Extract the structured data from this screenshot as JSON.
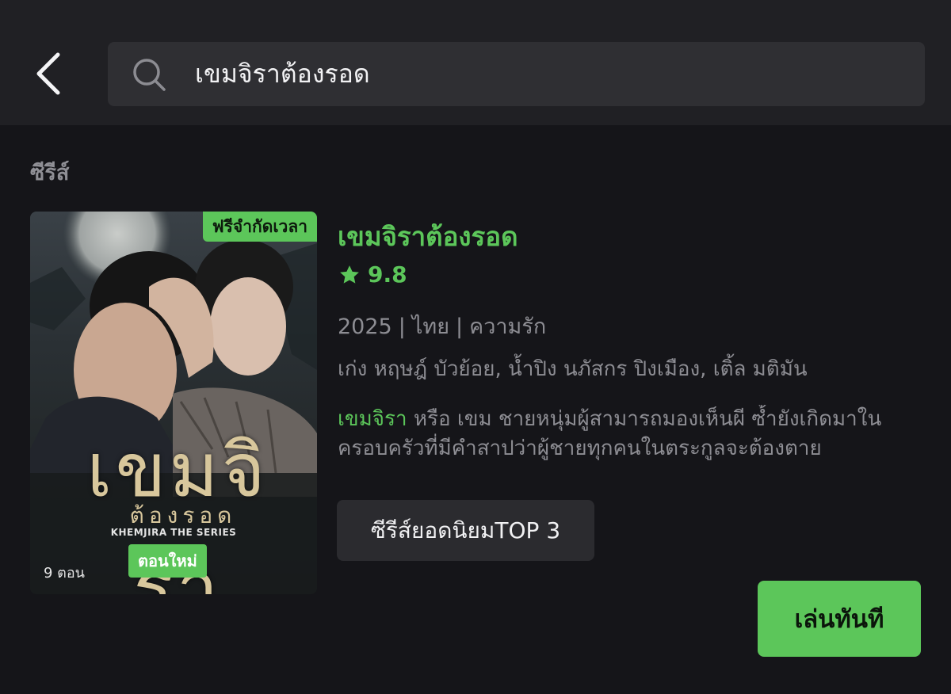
{
  "search": {
    "query": "เขมจิราต้องรอด"
  },
  "section": {
    "title": "ซีรีส์"
  },
  "result": {
    "badge_free": "ฟรีจำกัดเวลา",
    "poster_title": "เขมจิรา",
    "poster_subtitle": "ต้องรอด",
    "poster_en_title": "KHEMJIRA THE SERIES",
    "badge_new_episode": "ตอนใหม่",
    "episode_count": "9 ตอน",
    "title": "เขมจิราต้องรอด",
    "rating": "9.8",
    "year": "2025",
    "country": "ไทย",
    "genre": "ความรัก",
    "cast": "เก่ง หฤษฎ์ บัวย้อย, น้ำปิง นภัสกร ปิงเมือง, เติ้ล มติมัน",
    "description_highlight": "เขมจิรา",
    "description_rest": " หรือ เขม ชายหนุ่มผู้สามารถมองเห็นผี ซ้ำยังเกิดมาในครอบครัวที่มีคำสาปว่าผู้ชายทุกคนในตระกูลจะต้องตาย",
    "tag_chip": "ซีรีส์ยอดนิยมTOP 3",
    "play_label": "เล่นทันที"
  },
  "colors": {
    "accent": "#5cc65a",
    "background": "#151519",
    "topbar": "#202024",
    "muted_text": "#8d8d93"
  },
  "icons": {
    "back": "chevron-left-icon",
    "search": "search-icon",
    "rating": "star-icon"
  }
}
